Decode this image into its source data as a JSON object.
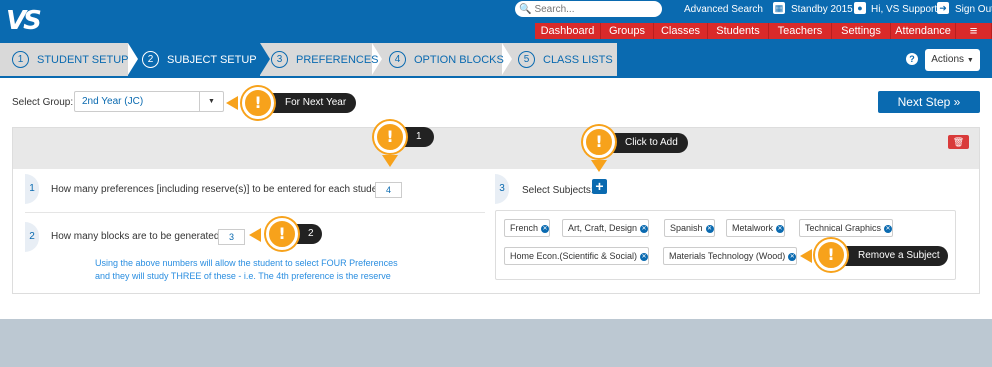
{
  "app": {
    "logo": "VS"
  },
  "top": {
    "search_placeholder": "Search...",
    "advanced_search": "Advanced Search",
    "standby": "Standby 2015",
    "user": "Hi, VS Support",
    "sign_out": "Sign Out"
  },
  "menu": [
    "Dashboard",
    "Groups",
    "Classes",
    "Students",
    "Teachers",
    "Settings",
    "Attendance"
  ],
  "steps": [
    {
      "num": "1",
      "label": "STUDENT SETUP"
    },
    {
      "num": "2",
      "label": "SUBJECT SETUP"
    },
    {
      "num": "3",
      "label": "PREFERENCES"
    },
    {
      "num": "4",
      "label": "OPTION BLOCKS"
    },
    {
      "num": "5",
      "label": "CLASS LISTS"
    }
  ],
  "actions_label": "Actions",
  "select_group": {
    "label": "Select Group:",
    "value": "2nd Year (JC)"
  },
  "next_step": "Next Step »",
  "questions": [
    {
      "num": "1",
      "text": "How many preferences [including reserve(s)] to be entered for each student?",
      "value": "4"
    },
    {
      "num": "2",
      "text": "How many blocks are to be generated?",
      "value": "3"
    }
  ],
  "info_text": "Using the above numbers will allow the student to select FOUR Preferences and they will study THREE of these - i.e. The 4th preference is the reserve",
  "subjects_section": {
    "num": "3",
    "label": "Select Subjects:"
  },
  "subjects": [
    "French",
    "Art, Craft, Design",
    "Spanish",
    "Metalwork",
    "Technical Graphics",
    "Home Econ.(Scientific & Social)",
    "Materials Technology (Wood)"
  ],
  "tips": {
    "next_year": "For Next Year",
    "one": "1",
    "add": "Click to Add",
    "two": "2",
    "remove": "Remove a Subject"
  },
  "colors": {
    "primary": "#0a6ab0",
    "menu": "#d92a2a",
    "tip": "#f7a21b"
  }
}
